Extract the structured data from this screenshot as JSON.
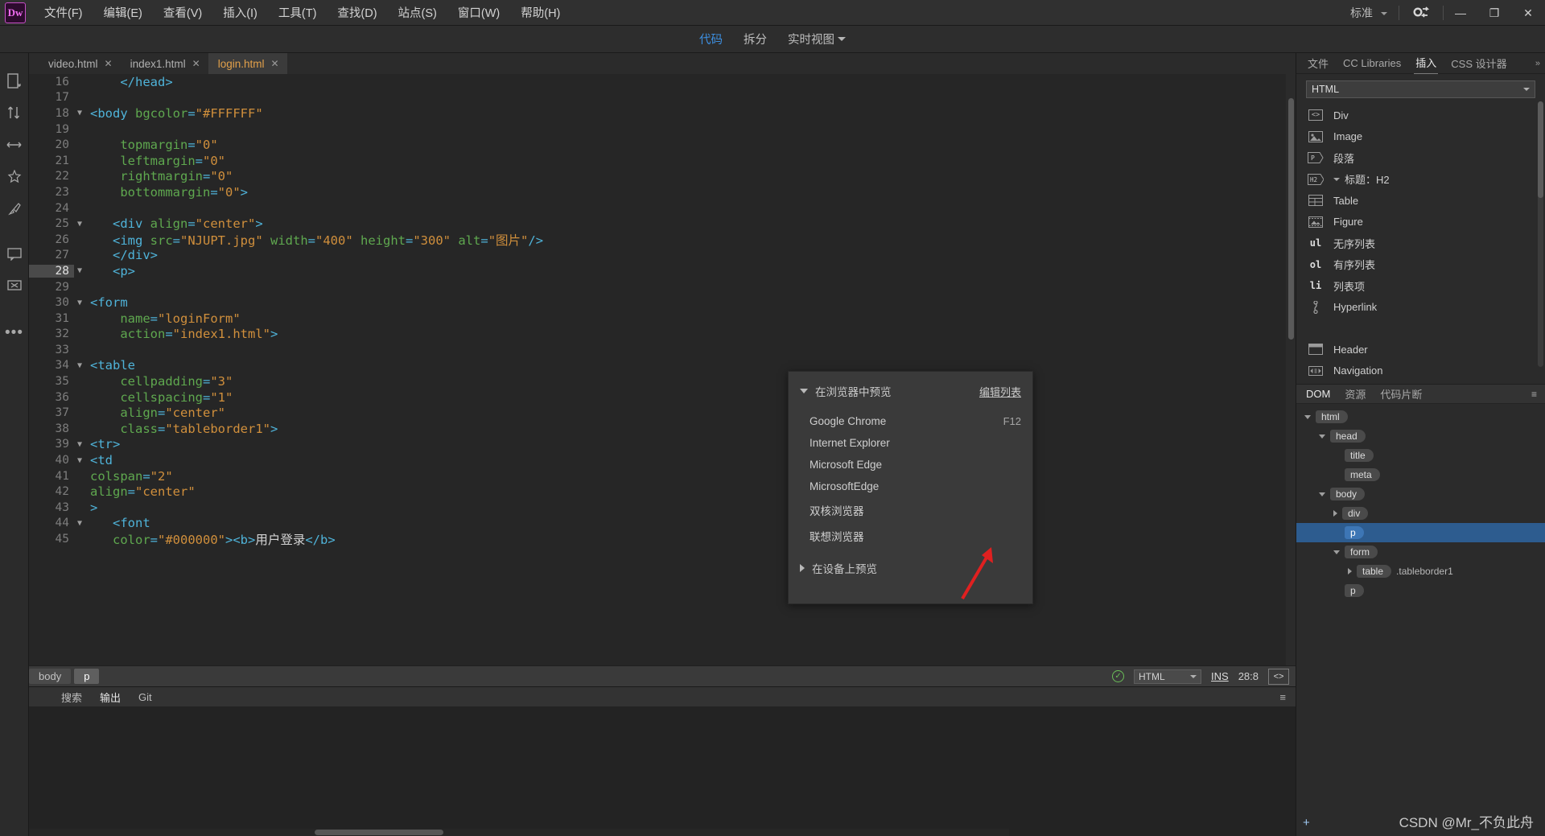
{
  "app": {
    "logo": "Dw",
    "workspace": "标准"
  },
  "menubar": [
    {
      "label": "文件(F)"
    },
    {
      "label": "编辑(E)"
    },
    {
      "label": "查看(V)"
    },
    {
      "label": "插入(I)"
    },
    {
      "label": "工具(T)"
    },
    {
      "label": "查找(D)"
    },
    {
      "label": "站点(S)"
    },
    {
      "label": "窗口(W)"
    },
    {
      "label": "帮助(H)"
    }
  ],
  "window_controls": {
    "minimize": "—",
    "restore": "❐",
    "close": "✕"
  },
  "viewbar": {
    "tabs": [
      {
        "label": "代码",
        "active": true
      },
      {
        "label": "拆分",
        "active": false
      },
      {
        "label": "实时视图",
        "active": false
      }
    ]
  },
  "file_tabs": [
    {
      "label": "video.html",
      "active": false,
      "close": "✕"
    },
    {
      "label": "index1.html",
      "active": false,
      "close": "✕"
    },
    {
      "label": "login.html",
      "active": true,
      "close": "✕"
    }
  ],
  "code": {
    "current_line": 28,
    "lines": [
      {
        "n": 16,
        "fold": "",
        "parts": [
          {
            "t": "pun",
            "s": "    </head>"
          }
        ]
      },
      {
        "n": 17,
        "fold": "",
        "parts": [
          {
            "t": "txt",
            "s": ""
          }
        ]
      },
      {
        "n": 18,
        "fold": "▼",
        "parts": [
          {
            "t": "tag",
            "s": "<body "
          },
          {
            "t": "attr",
            "s": "bgcolor"
          },
          {
            "t": "pun",
            "s": "="
          },
          {
            "t": "val",
            "s": "\"#FFFFFF\""
          }
        ]
      },
      {
        "n": 19,
        "fold": "",
        "parts": [
          {
            "t": "txt",
            "s": ""
          }
        ]
      },
      {
        "n": 20,
        "fold": "",
        "parts": [
          {
            "t": "attr",
            "s": "    topmargin"
          },
          {
            "t": "pun",
            "s": "="
          },
          {
            "t": "val",
            "s": "\"0\""
          }
        ]
      },
      {
        "n": 21,
        "fold": "",
        "parts": [
          {
            "t": "attr",
            "s": "    leftmargin"
          },
          {
            "t": "pun",
            "s": "="
          },
          {
            "t": "val",
            "s": "\"0\""
          }
        ]
      },
      {
        "n": 22,
        "fold": "",
        "parts": [
          {
            "t": "attr",
            "s": "    rightmargin"
          },
          {
            "t": "pun",
            "s": "="
          },
          {
            "t": "val",
            "s": "\"0\""
          }
        ]
      },
      {
        "n": 23,
        "fold": "",
        "parts": [
          {
            "t": "attr",
            "s": "    bottommargin"
          },
          {
            "t": "pun",
            "s": "="
          },
          {
            "t": "val",
            "s": "\"0\""
          },
          {
            "t": "tag",
            "s": ">"
          }
        ]
      },
      {
        "n": 24,
        "fold": "",
        "parts": [
          {
            "t": "txt",
            "s": ""
          }
        ]
      },
      {
        "n": 25,
        "fold": "▼",
        "parts": [
          {
            "t": "tag",
            "s": "   <div "
          },
          {
            "t": "attr",
            "s": "align"
          },
          {
            "t": "pun",
            "s": "="
          },
          {
            "t": "val",
            "s": "\"center\""
          },
          {
            "t": "tag",
            "s": ">"
          }
        ]
      },
      {
        "n": 26,
        "fold": "",
        "parts": [
          {
            "t": "tag",
            "s": "   <img "
          },
          {
            "t": "attr",
            "s": "src"
          },
          {
            "t": "pun",
            "s": "="
          },
          {
            "t": "val",
            "s": "\"NJUPT.jpg\""
          },
          {
            "t": "attr",
            "s": " width"
          },
          {
            "t": "pun",
            "s": "="
          },
          {
            "t": "val",
            "s": "\"400\""
          },
          {
            "t": "attr",
            "s": " height"
          },
          {
            "t": "pun",
            "s": "="
          },
          {
            "t": "val",
            "s": "\"300\""
          },
          {
            "t": "attr",
            "s": " alt"
          },
          {
            "t": "pun",
            "s": "="
          },
          {
            "t": "val",
            "s": "\"图片\""
          },
          {
            "t": "tag",
            "s": "/>"
          }
        ]
      },
      {
        "n": 27,
        "fold": "",
        "parts": [
          {
            "t": "tag",
            "s": "   </div>"
          }
        ]
      },
      {
        "n": 28,
        "fold": "▼",
        "parts": [
          {
            "t": "tag",
            "s": "   <p>"
          }
        ]
      },
      {
        "n": 29,
        "fold": "",
        "parts": [
          {
            "t": "txt",
            "s": ""
          }
        ]
      },
      {
        "n": 30,
        "fold": "▼",
        "parts": [
          {
            "t": "tag",
            "s": "<form"
          }
        ]
      },
      {
        "n": 31,
        "fold": "",
        "parts": [
          {
            "t": "attr",
            "s": "    name"
          },
          {
            "t": "pun",
            "s": "="
          },
          {
            "t": "val",
            "s": "\"loginForm\""
          }
        ]
      },
      {
        "n": 32,
        "fold": "",
        "parts": [
          {
            "t": "attr",
            "s": "    action"
          },
          {
            "t": "pun",
            "s": "="
          },
          {
            "t": "val",
            "s": "\"index1.html\""
          },
          {
            "t": "tag",
            "s": ">"
          }
        ]
      },
      {
        "n": 33,
        "fold": "",
        "parts": [
          {
            "t": "txt",
            "s": ""
          }
        ]
      },
      {
        "n": 34,
        "fold": "▼",
        "parts": [
          {
            "t": "tag",
            "s": "<table"
          }
        ]
      },
      {
        "n": 35,
        "fold": "",
        "parts": [
          {
            "t": "attr",
            "s": "    cellpadding"
          },
          {
            "t": "pun",
            "s": "="
          },
          {
            "t": "val",
            "s": "\"3\""
          }
        ]
      },
      {
        "n": 36,
        "fold": "",
        "parts": [
          {
            "t": "attr",
            "s": "    cellspacing"
          },
          {
            "t": "pun",
            "s": "="
          },
          {
            "t": "val",
            "s": "\"1\""
          }
        ]
      },
      {
        "n": 37,
        "fold": "",
        "parts": [
          {
            "t": "attr",
            "s": "    align"
          },
          {
            "t": "pun",
            "s": "="
          },
          {
            "t": "val",
            "s": "\"center\""
          }
        ]
      },
      {
        "n": 38,
        "fold": "",
        "parts": [
          {
            "t": "attr",
            "s": "    class"
          },
          {
            "t": "pun",
            "s": "="
          },
          {
            "t": "val",
            "s": "\"tableborder1\""
          },
          {
            "t": "tag",
            "s": ">"
          }
        ]
      },
      {
        "n": 39,
        "fold": "▼",
        "parts": [
          {
            "t": "tag",
            "s": "<tr>"
          }
        ]
      },
      {
        "n": 40,
        "fold": "▼",
        "parts": [
          {
            "t": "tag",
            "s": "<td"
          }
        ]
      },
      {
        "n": 41,
        "fold": "",
        "parts": [
          {
            "t": "attr",
            "s": "colspan"
          },
          {
            "t": "pun",
            "s": "="
          },
          {
            "t": "val",
            "s": "\"2\""
          }
        ]
      },
      {
        "n": 42,
        "fold": "",
        "parts": [
          {
            "t": "attr",
            "s": "align"
          },
          {
            "t": "pun",
            "s": "="
          },
          {
            "t": "val",
            "s": "\"center\""
          }
        ]
      },
      {
        "n": 43,
        "fold": "",
        "parts": [
          {
            "t": "tag",
            "s": ">"
          }
        ]
      },
      {
        "n": 44,
        "fold": "▼",
        "parts": [
          {
            "t": "tag",
            "s": "   <font"
          }
        ]
      },
      {
        "n": 45,
        "fold": "",
        "parts": [
          {
            "t": "attr",
            "s": "   color"
          },
          {
            "t": "pun",
            "s": "="
          },
          {
            "t": "val",
            "s": "\"#000000\""
          },
          {
            "t": "tag",
            "s": "><b>"
          },
          {
            "t": "txt",
            "s": "用户登录"
          },
          {
            "t": "tag",
            "s": "</b>"
          }
        ]
      }
    ]
  },
  "preview_popup": {
    "title": "在浏览器中预览",
    "edit_list": "编辑列表",
    "browsers": [
      {
        "name": "Google Chrome",
        "shortcut": "F12"
      },
      {
        "name": "Internet Explorer",
        "shortcut": ""
      },
      {
        "name": "Microsoft Edge",
        "shortcut": ""
      },
      {
        "name": "MicrosoftEdge",
        "shortcut": ""
      },
      {
        "name": "双核浏览器",
        "shortcut": ""
      },
      {
        "name": "联想浏览器",
        "shortcut": ""
      }
    ],
    "device_preview": "在设备上预览"
  },
  "statusbar": {
    "breadcrumbs": [
      {
        "label": "body",
        "selected": false
      },
      {
        "label": "p",
        "selected": true
      }
    ],
    "format": "HTML",
    "ins": "INS",
    "position": "28:8",
    "code_view_icon": "<>"
  },
  "bottom_panel": {
    "tabs": [
      {
        "label": "搜索",
        "active": false
      },
      {
        "label": "输出",
        "active": true
      },
      {
        "label": "Git",
        "active": false
      }
    ],
    "menu_icon": "≡"
  },
  "right_panel": {
    "tabs": [
      {
        "label": "文件",
        "active": false
      },
      {
        "label": "CC Libraries",
        "active": false
      },
      {
        "label": "插入",
        "active": true
      },
      {
        "label": "CSS 设计器",
        "active": false
      }
    ],
    "category": "HTML",
    "items": [
      {
        "label": "Div",
        "icon": "<>"
      },
      {
        "label": "Image",
        "icon": "image"
      },
      {
        "label": "段落",
        "icon": "P"
      },
      {
        "label": "标题：H2",
        "icon": "H2",
        "caret": true
      },
      {
        "label": "Table",
        "icon": "table"
      },
      {
        "label": "Figure",
        "icon": "figure"
      },
      {
        "label": "无序列表",
        "icon": "ul"
      },
      {
        "label": "有序列表",
        "icon": "ol"
      },
      {
        "label": "列表项",
        "icon": "li"
      },
      {
        "label": "Hyperlink",
        "icon": "link"
      },
      {
        "label": "Header",
        "icon": "header"
      },
      {
        "label": "Navigation",
        "icon": "nav"
      }
    ]
  },
  "dom_panel": {
    "tabs": [
      {
        "label": "DOM",
        "active": true
      },
      {
        "label": "资源",
        "active": false
      },
      {
        "label": "代码片断",
        "active": false
      }
    ],
    "menu_icon": "≡",
    "add_icon": "+",
    "nodes": [
      {
        "tag": "html",
        "indent": 0,
        "twisty": "down",
        "selected": false,
        "class": ""
      },
      {
        "tag": "head",
        "indent": 1,
        "twisty": "down",
        "selected": false,
        "class": ""
      },
      {
        "tag": "title",
        "indent": 2,
        "twisty": "none",
        "selected": false,
        "class": ""
      },
      {
        "tag": "meta",
        "indent": 2,
        "twisty": "none",
        "selected": false,
        "class": ""
      },
      {
        "tag": "body",
        "indent": 1,
        "twisty": "down",
        "selected": false,
        "class": ""
      },
      {
        "tag": "div",
        "indent": 2,
        "twisty": "right",
        "selected": false,
        "class": ""
      },
      {
        "tag": "p",
        "indent": 2,
        "twisty": "none",
        "selected": true,
        "class": ""
      },
      {
        "tag": "form",
        "indent": 2,
        "twisty": "down",
        "selected": false,
        "class": ""
      },
      {
        "tag": "table",
        "indent": 3,
        "twisty": "right",
        "selected": false,
        "class": ".tableborder1"
      },
      {
        "tag": "p",
        "indent": 2,
        "twisty": "none",
        "selected": false,
        "class": ""
      }
    ]
  },
  "watermark": "CSDN @Mr_不负此舟"
}
